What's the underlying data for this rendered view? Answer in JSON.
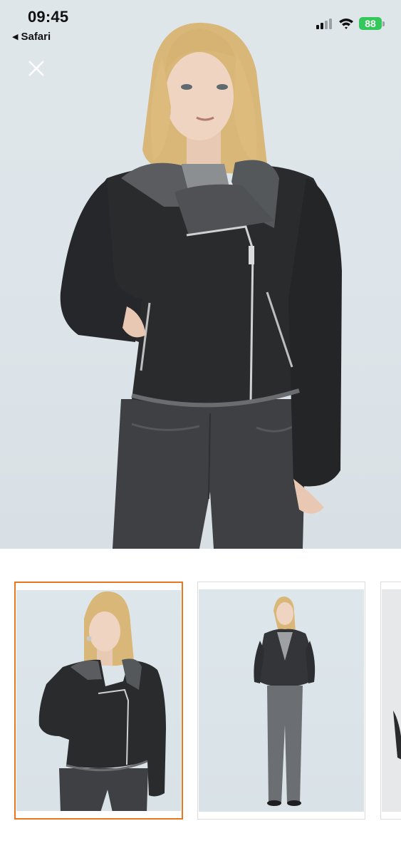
{
  "status_bar": {
    "time": "09:45",
    "back_app": "Safari",
    "battery_level": "88",
    "battery_color": "#34c759"
  },
  "hero": {
    "image": "woman-in-black-shearling-biker-jacket-icon"
  },
  "close": {
    "icon": "close-icon"
  },
  "thumbnails": [
    {
      "image": "jacket-closeup-icon",
      "selected": true,
      "accent": "#e87722"
    },
    {
      "image": "full-length-outfit-icon",
      "selected": false
    },
    {
      "image": "jacket-detail-icon",
      "selected": false
    }
  ]
}
